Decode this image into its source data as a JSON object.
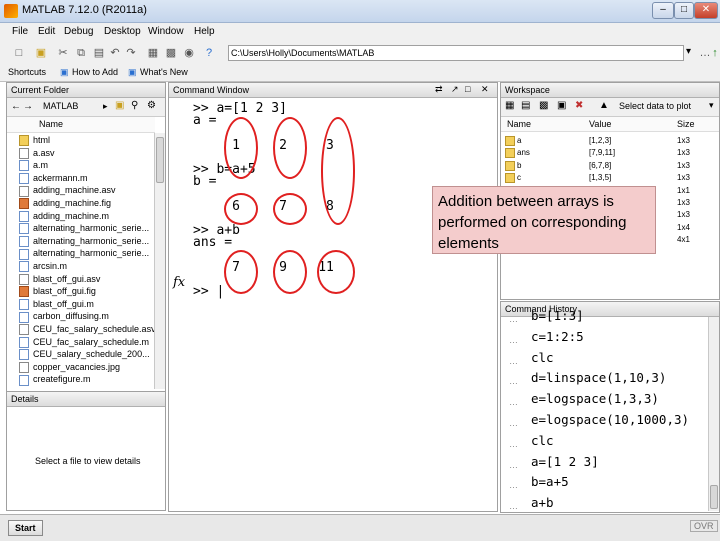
{
  "window": {
    "title": "MATLAB 7.12.0 (R2011a)",
    "minimize": "–",
    "maximize": "□",
    "close": "✕"
  },
  "menu": [
    "File",
    "Edit",
    "Debug",
    "Desktop",
    "Window",
    "Help"
  ],
  "toolbar": {
    "path": "C:\\Users\\Holly\\Documents\\MATLAB"
  },
  "shortcuts": {
    "label": "Shortcuts",
    "how_to_add": "How to Add",
    "whats_new": "What's New"
  },
  "current_folder": {
    "title": "Current Folder",
    "path_label": "MATLAB",
    "column": "Name",
    "files": [
      {
        "name": "html",
        "type": "folder"
      },
      {
        "name": "a.asv",
        "type": "file"
      },
      {
        "name": "a.m",
        "type": "m"
      },
      {
        "name": "ackermann.m",
        "type": "m"
      },
      {
        "name": "adding_machine.asv",
        "type": "file"
      },
      {
        "name": "adding_machine.fig",
        "type": "fig"
      },
      {
        "name": "adding_machine.m",
        "type": "m"
      },
      {
        "name": "alternating_harmonic_serie...",
        "type": "m"
      },
      {
        "name": "alternating_harmonic_serie...",
        "type": "m"
      },
      {
        "name": "alternating_harmonic_serie...",
        "type": "m"
      },
      {
        "name": "arcsin.m",
        "type": "m"
      },
      {
        "name": "blast_off_gui.asv",
        "type": "file"
      },
      {
        "name": "blast_off_gui.fig",
        "type": "fig"
      },
      {
        "name": "blast_off_gui.m",
        "type": "m"
      },
      {
        "name": "carbon_diffusing.m",
        "type": "m"
      },
      {
        "name": "CEU_fac_salary_schedule.asv",
        "type": "file"
      },
      {
        "name": "CEU_fac_salary_schedule.m",
        "type": "m"
      },
      {
        "name": "CEU_salary_schedule_200...",
        "type": "m"
      },
      {
        "name": "copper_vacancies.jpg",
        "type": "file"
      },
      {
        "name": "createfigure.m",
        "type": "m"
      }
    ]
  },
  "details": {
    "title": "Details",
    "message": "Select a file to view details"
  },
  "command_window": {
    "title": "Command Window",
    "lines": [
      ">> a=[1 2 3]",
      "a =",
      "",
      "     1     2     3",
      "",
      ">> b=a+5",
      "b =",
      "",
      "     6     7     8",
      "",
      ">> a+b",
      "ans =",
      "",
      "     7     9    11",
      "",
      ">> |"
    ],
    "fx": "fx"
  },
  "workspace": {
    "title": "Workspace",
    "plot_select": "Select data to plot",
    "columns": [
      "Name",
      "Value",
      "Size"
    ],
    "rows": [
      {
        "name": "a",
        "value": "[1,2,3]",
        "size": "1x3"
      },
      {
        "name": "ans",
        "value": "[7,9,11]",
        "size": "1x3"
      },
      {
        "name": "b",
        "value": "[6,7,8]",
        "size": "1x3"
      },
      {
        "name": "c",
        "value": "[1,3,5]",
        "size": "1x3"
      },
      {
        "name": "",
        "value": "",
        "size": "1x1"
      },
      {
        "name": "",
        "value": "",
        "size": "1x3"
      },
      {
        "name": "",
        "value": "",
        "size": "1x3"
      },
      {
        "name": "",
        "value": "",
        "size": "1x4"
      },
      {
        "name": "",
        "value": "",
        "size": "4x1"
      }
    ]
  },
  "command_history": {
    "title": "Command History",
    "lines": [
      "b=[1:3]",
      "c=1:2:5",
      "clc",
      "d=linspace(1,10,3)",
      "e=logspace(1,3,3)",
      "e=logspace(10,1000,3)",
      "clc",
      "a=[1 2 3]",
      "b=a+5",
      "a+b"
    ]
  },
  "annotation": {
    "text": "Addition between arrays is performed on corresponding elements"
  },
  "status": {
    "start": "Start",
    "ovr": "OVR"
  },
  "colors": {
    "circle": "#e02020",
    "annotation_bg": "#f4cccc"
  }
}
